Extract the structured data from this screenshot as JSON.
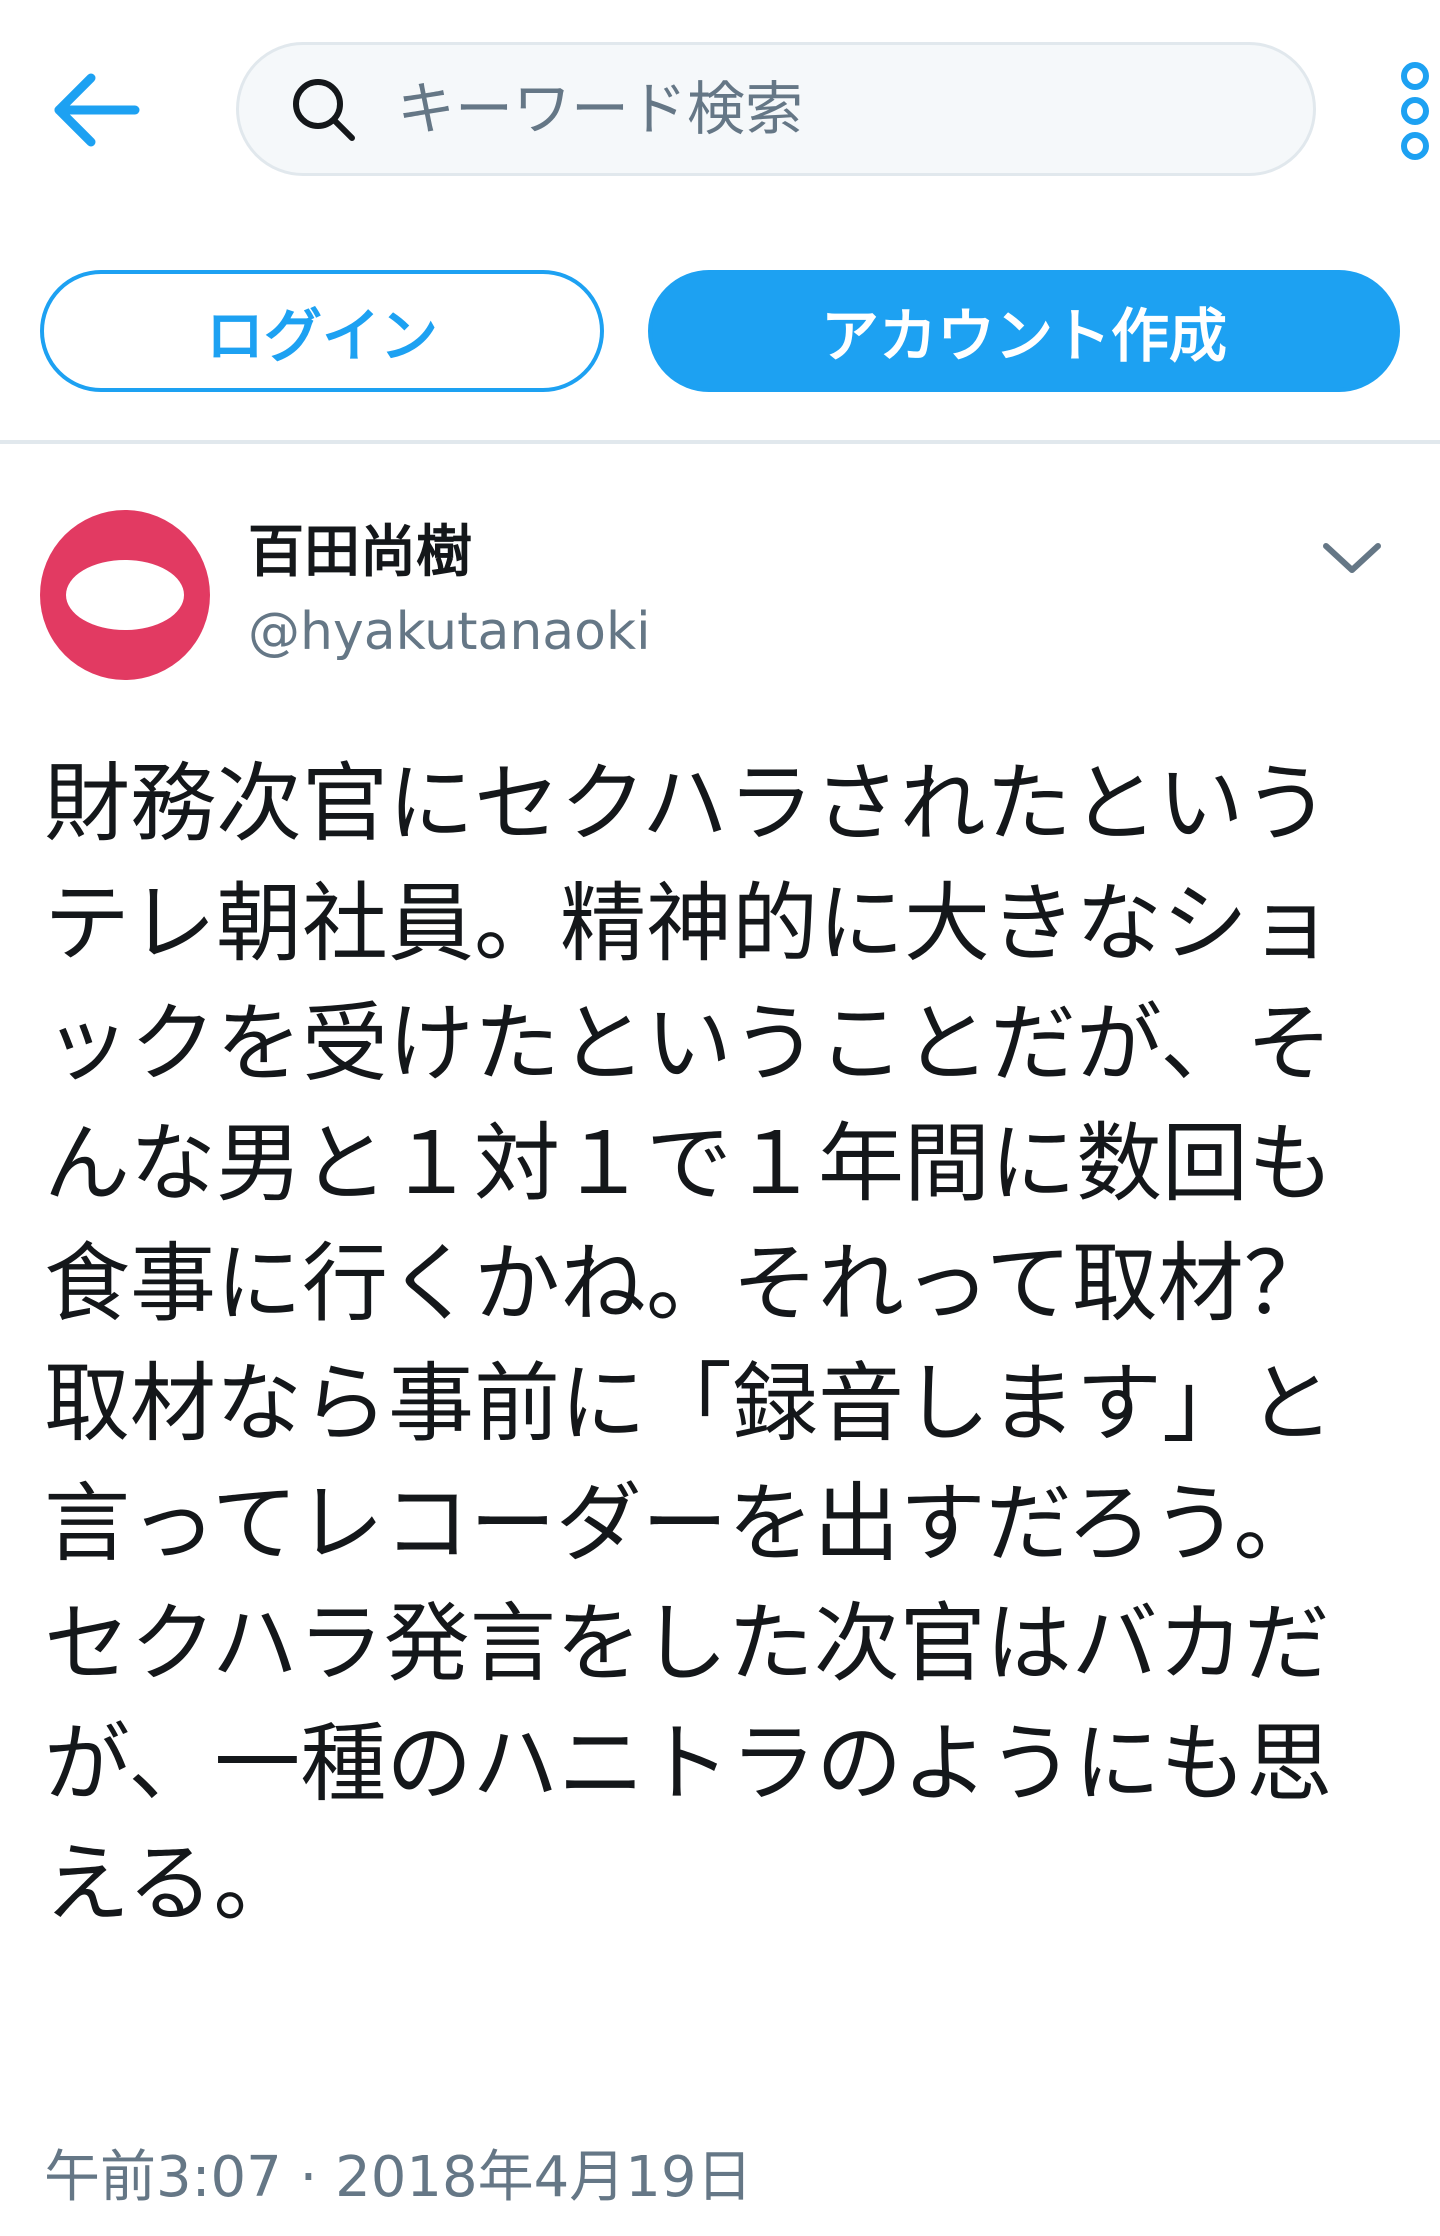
{
  "search": {
    "placeholder": "キーワード検索",
    "value": ""
  },
  "auth": {
    "login_label": "ログイン",
    "signup_label": "アカウント作成"
  },
  "tweet": {
    "display_name": "百田尚樹",
    "handle": "@hyakutanaoki",
    "text": "財務次官にセクハラされたというテレ朝社員。精神的に大きなショックを受けたということだが、そんな男と１対１で１年間に数回も食事に行くかね。それって取材？取材なら事前に「録音します」と言ってレコーダーを出すだろう。\nセクハラ発言をした次官はバカだが、一種のハニトラのようにも思える。",
    "timestamp": "午前3:07 · 2018年4月19日"
  },
  "icons": {
    "back": "arrow-left-icon",
    "search": "search-icon",
    "more": "more-vertical-icon",
    "caret": "chevron-down-icon"
  },
  "colors": {
    "accent": "#1da1f2",
    "avatar_bg": "#e23a62",
    "secondary_text": "#657786",
    "divider": "#e1e8ed"
  }
}
